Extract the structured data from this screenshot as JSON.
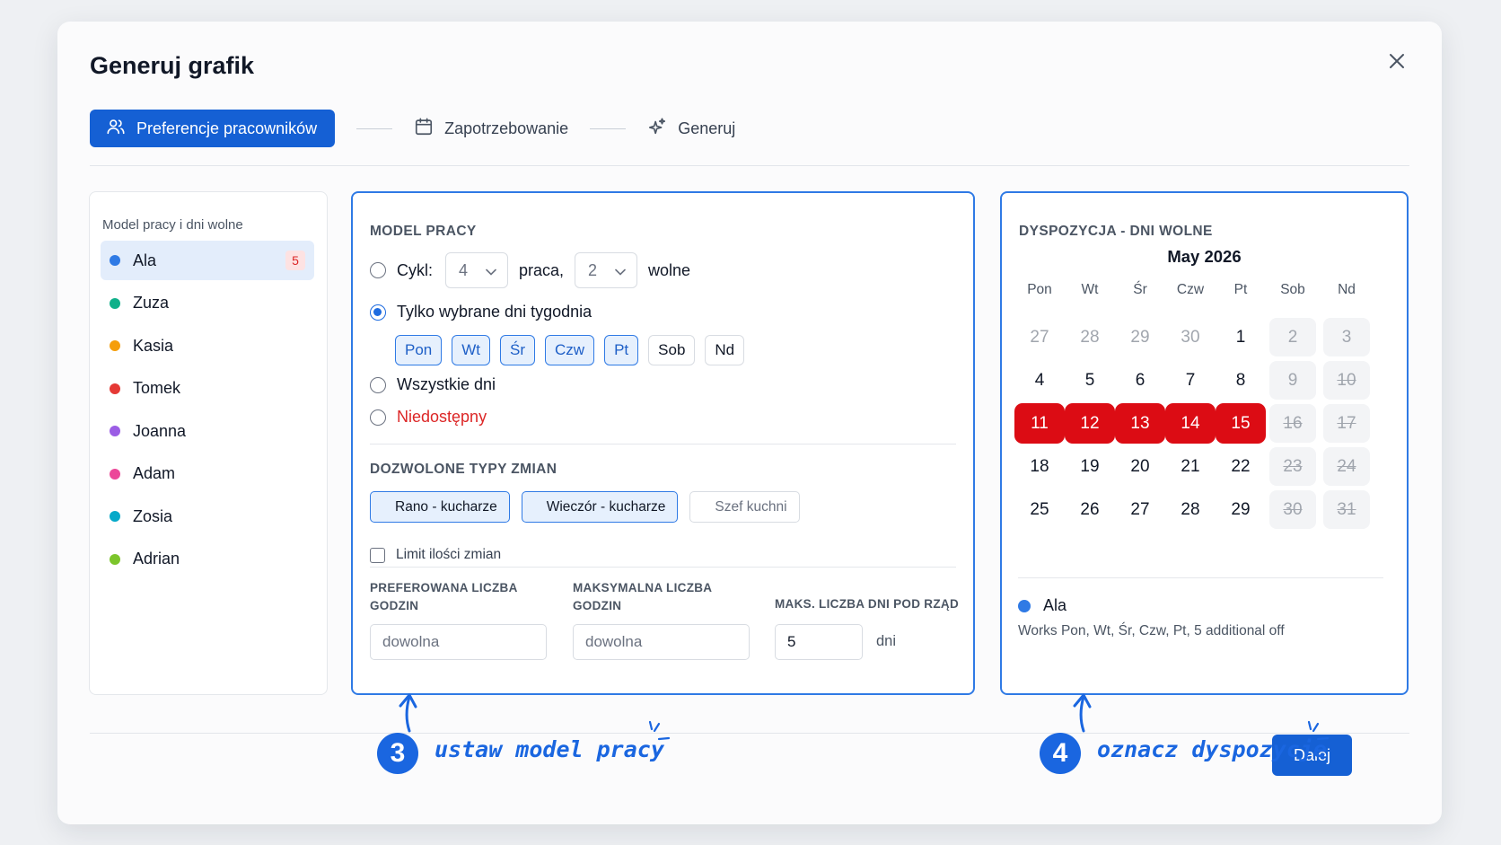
{
  "modal": {
    "title": "Generuj grafik"
  },
  "stepper": {
    "steps": [
      {
        "label": "Preferencje pracowników",
        "icon": "users-icon",
        "active": true
      },
      {
        "label": "Zapotrzebowanie",
        "icon": "calendar-icon",
        "active": false
      },
      {
        "label": "Generuj",
        "icon": "sparkles-icon",
        "active": false
      }
    ]
  },
  "employees": {
    "title": "Model pracy i dni wolne",
    "items": [
      {
        "name": "Ala",
        "color": "#2f7ae5",
        "badge": "5",
        "selected": true
      },
      {
        "name": "Zuza",
        "color": "#10b08a"
      },
      {
        "name": "Kasia",
        "color": "#f59e0b"
      },
      {
        "name": "Tomek",
        "color": "#e53935"
      },
      {
        "name": "Joanna",
        "color": "#9b5de5"
      },
      {
        "name": "Adam",
        "color": "#ec4899"
      },
      {
        "name": "Zosia",
        "color": "#06a9c9"
      },
      {
        "name": "Adrian",
        "color": "#7cc52b"
      }
    ]
  },
  "work_model": {
    "heading": "MODEL PRACY",
    "cycle_label": "Cykl:",
    "cycle_work_value": "4",
    "cycle_work_label": "praca,",
    "cycle_off_value": "2",
    "cycle_off_label": "wolne",
    "selected_days_label": "Tylko wybrane dni tygodnia",
    "days": [
      {
        "label": "Pon",
        "on": true
      },
      {
        "label": "Wt",
        "on": true
      },
      {
        "label": "Śr",
        "on": true
      },
      {
        "label": "Czw",
        "on": true
      },
      {
        "label": "Pt",
        "on": true
      },
      {
        "label": "Sob",
        "on": false
      },
      {
        "label": "Nd",
        "on": false
      }
    ],
    "all_days_label": "Wszystkie dni",
    "unavailable_label": "Niedostępny",
    "unavailable_color": "#dc2626",
    "shift_types_heading": "DOZWOLONE TYPY ZMIAN",
    "shifts": [
      {
        "label": "Rano - kucharze",
        "on": true
      },
      {
        "label": "Wieczór - kucharze",
        "on": true
      },
      {
        "label": "Szef kuchni",
        "on": false
      }
    ],
    "limit_label": "Limit ilości zmian",
    "preferred_hours_label": "PREFEROWANA LICZBA GODZIN",
    "preferred_hours_placeholder": "dowolna",
    "max_hours_label": "MAKSYMALNA LICZBA GODZIN",
    "max_hours_placeholder": "dowolna",
    "max_days_label": "MAKS. LICZBA DNI POD RZĄD",
    "max_days_value": "5",
    "max_days_unit": "dni"
  },
  "availability": {
    "heading": "DYSPOZYCJA - DNI WOLNE",
    "month": "May 2026",
    "weekdays": [
      "Pon",
      "Wt",
      "Śr",
      "Czw",
      "Pt",
      "Sob",
      "Nd"
    ],
    "weeks": [
      [
        "27",
        "28",
        "29",
        "30",
        "1",
        "2",
        "3"
      ],
      [
        "4",
        "5",
        "6",
        "7",
        "8",
        "9",
        "10"
      ],
      [
        "11",
        "12",
        "13",
        "14",
        "15",
        "16",
        "17"
      ],
      [
        "18",
        "19",
        "20",
        "21",
        "22",
        "23",
        "24"
      ],
      [
        "25",
        "26",
        "27",
        "28",
        "29",
        "30",
        "31"
      ]
    ],
    "off_days": [
      "11",
      "12",
      "13",
      "14",
      "15"
    ],
    "off_color": "#dc0c14",
    "legend_name": "Ala",
    "legend_desc": "Works Pon, Wt, Śr, Czw, Pt, 5 additional off"
  },
  "footer": {
    "next_label": "Dalej"
  },
  "annotations": [
    {
      "number": "3",
      "text": "ustaw model pracy"
    },
    {
      "number": "4",
      "text": "oznacz dyspozycje"
    }
  ],
  "accent_color": "#1560d4"
}
